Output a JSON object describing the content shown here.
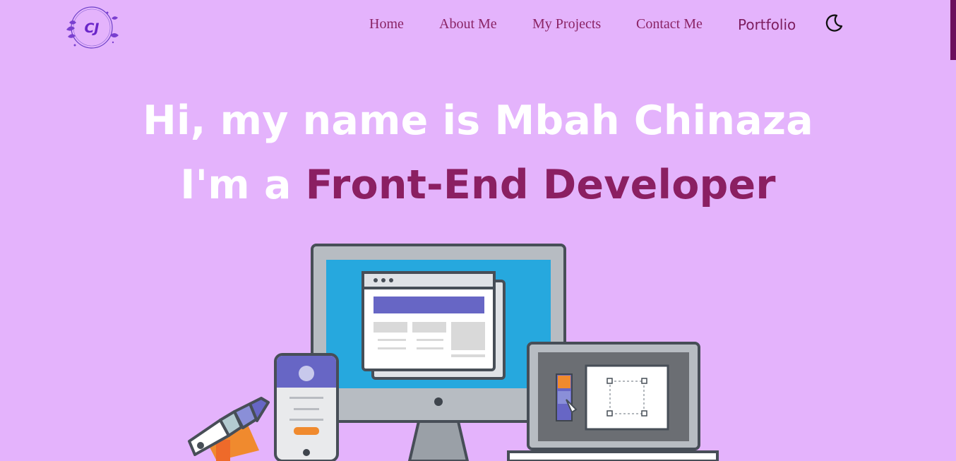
{
  "logo": {
    "text": "CJ"
  },
  "nav": {
    "items": [
      {
        "label": "Home"
      },
      {
        "label": "About Me"
      },
      {
        "label": "My Projects"
      },
      {
        "label": "Contact Me"
      }
    ],
    "portfolio_label": "Portfolio",
    "theme_toggle_icon": "moon-icon"
  },
  "hero": {
    "greeting": "Hi, my name is Mbah Chinaza",
    "role_prefix": "I'm a ",
    "role": "Front-End Developer"
  },
  "colors": {
    "background": "#e4b3fc",
    "accent": "#8b1f62",
    "nav_text": "#8b2466",
    "hero_text": "#ffffff"
  }
}
